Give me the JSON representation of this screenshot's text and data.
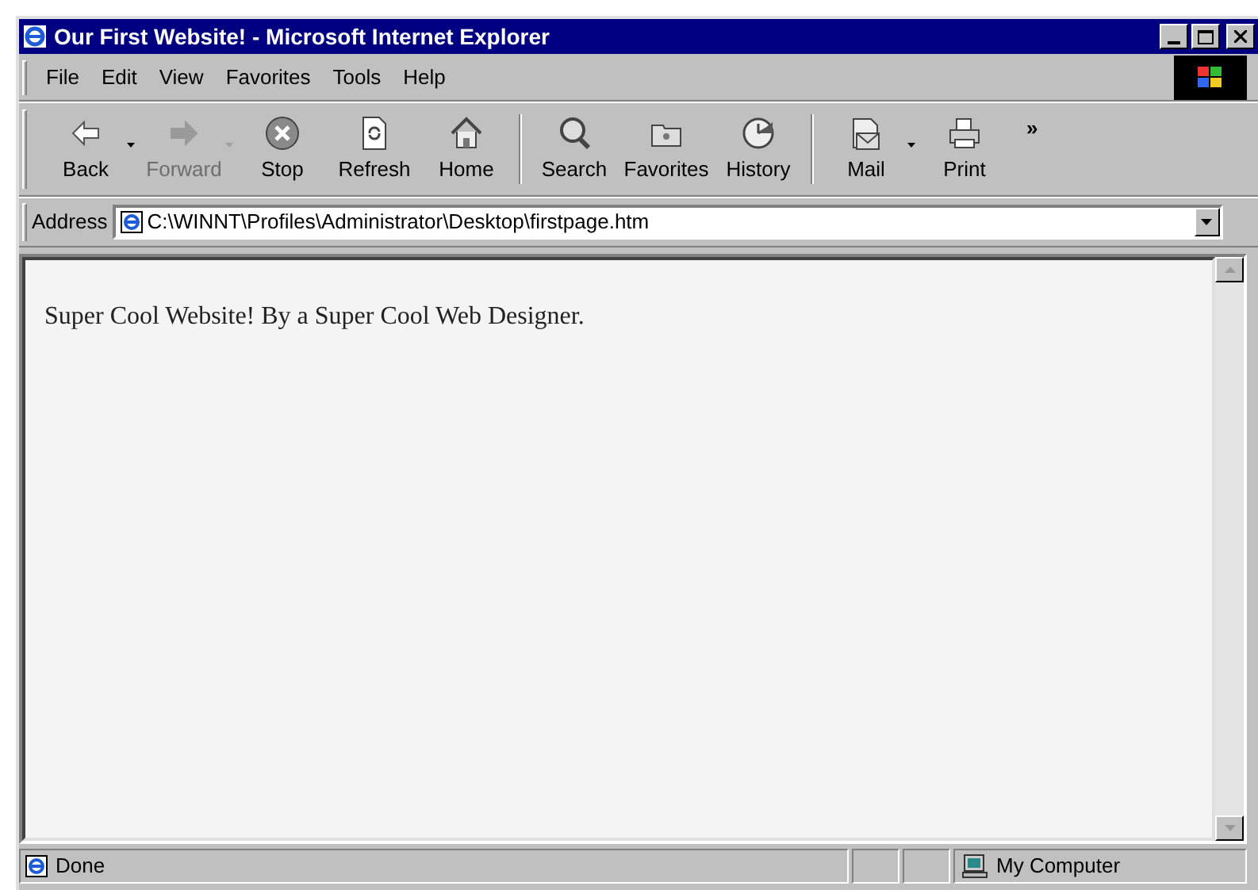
{
  "window": {
    "title": "Our First Website! - Microsoft Internet Explorer"
  },
  "menu": [
    {
      "label": "File"
    },
    {
      "label": "Edit"
    },
    {
      "label": "View"
    },
    {
      "label": "Favorites"
    },
    {
      "label": "Tools"
    },
    {
      "label": "Help"
    }
  ],
  "toolbar_groups": [
    {
      "buttons": [
        {
          "kind": "back",
          "label": "Back",
          "disabled": false,
          "dropdown": true
        },
        {
          "kind": "forward",
          "label": "Forward",
          "disabled": true,
          "dropdown": true
        },
        {
          "kind": "stop",
          "label": "Stop",
          "disabled": false,
          "dropdown": false
        },
        {
          "kind": "refresh",
          "label": "Refresh",
          "disabled": false,
          "dropdown": false
        },
        {
          "kind": "home",
          "label": "Home",
          "disabled": false,
          "dropdown": false
        }
      ]
    },
    {
      "buttons": [
        {
          "kind": "search",
          "label": "Search",
          "disabled": false,
          "dropdown": false
        },
        {
          "kind": "favorites",
          "label": "Favorites",
          "disabled": false,
          "dropdown": false
        },
        {
          "kind": "history",
          "label": "History",
          "disabled": false,
          "dropdown": false
        }
      ]
    },
    {
      "buttons": [
        {
          "kind": "mail",
          "label": "Mail",
          "disabled": false,
          "dropdown": true
        },
        {
          "kind": "print",
          "label": "Print",
          "disabled": false,
          "dropdown": false
        }
      ]
    }
  ],
  "toolbar_overflow": "»",
  "address": {
    "label": "Address",
    "value": "C:\\WINNT\\Profiles\\Administrator\\Desktop\\firstpage.htm"
  },
  "page": {
    "text": "Super Cool Website! By a Super Cool Web Designer."
  },
  "status_bar": {
    "text": "Done",
    "zone": "My Computer"
  }
}
